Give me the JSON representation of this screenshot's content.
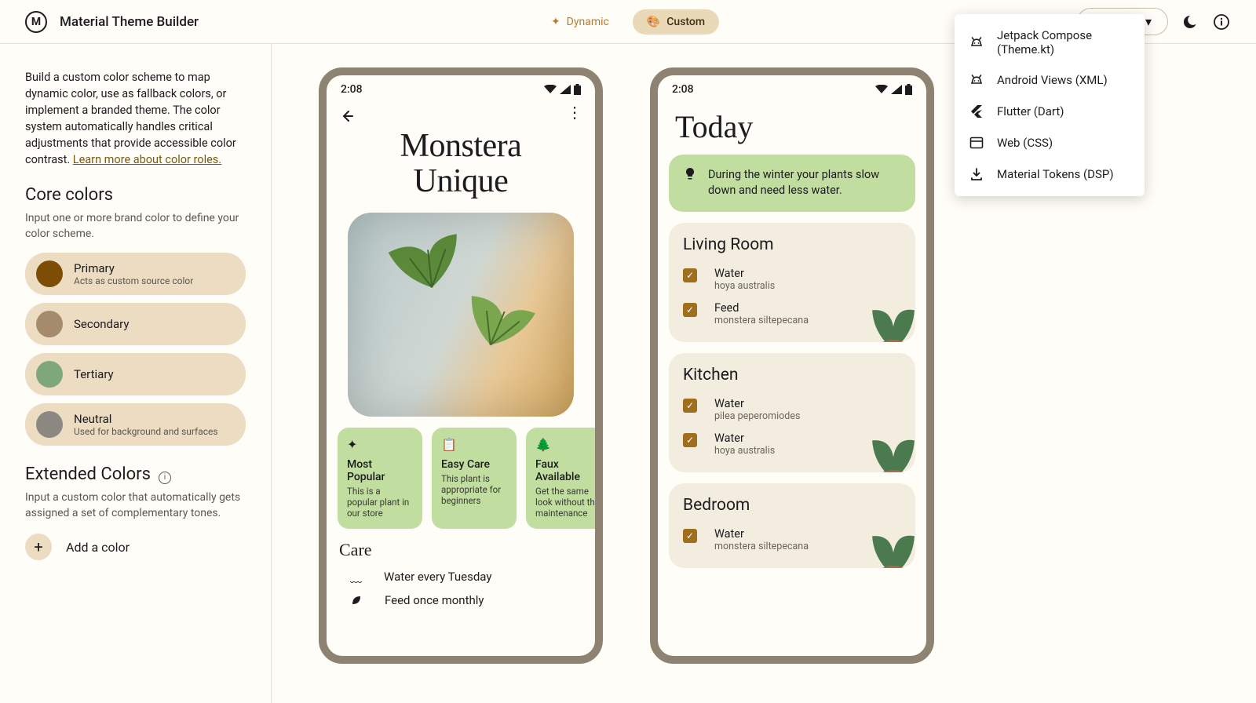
{
  "header": {
    "appTitle": "Material Theme Builder",
    "tabs": {
      "dynamic": "Dynamic",
      "custom": "Custom"
    },
    "exportMenu": [
      "Jetpack Compose (Theme.kt)",
      "Android Views (XML)",
      "Flutter (Dart)",
      "Web (CSS)",
      "Material Tokens (DSP)"
    ]
  },
  "sidebar": {
    "introA": "Build a custom color scheme to map dynamic color, use as fallback colors, or implement a branded theme. The color system automatically handles critical adjustments that provide accessible color contrast. ",
    "introLink": "Learn more about color roles.",
    "coreH": "Core colors",
    "coreSub": "Input one or more brand color to define your color scheme.",
    "colors": [
      {
        "label": "Primary",
        "sub": "Acts as custom source color",
        "hex": "#7e4d05"
      },
      {
        "label": "Secondary",
        "sub": "",
        "hex": "#a58a6c"
      },
      {
        "label": "Tertiary",
        "sub": "",
        "hex": "#7ea77b"
      },
      {
        "label": "Neutral",
        "sub": "Used for background and surfaces",
        "hex": "#8c8781"
      }
    ],
    "extH": "Extended Colors",
    "extSub": "Input a custom color that automatically gets assigned a set of complementary tones.",
    "addLabel": "Add a color"
  },
  "preview1": {
    "time": "2:08",
    "title1": "Monstera",
    "title2": "Unique",
    "chips": [
      {
        "title": "Most Popular",
        "desc": "This is a popular plant in our store"
      },
      {
        "title": "Easy Care",
        "desc": "This plant is appropriate for beginners"
      },
      {
        "title": "Faux Available",
        "desc": "Get the same look without the maintenance"
      }
    ],
    "careH": "Care",
    "care": [
      "Water every Tuesday",
      "Feed once monthly"
    ]
  },
  "preview2": {
    "time": "2:08",
    "title": "Today",
    "banner": "During the winter your plants slow down and need less water.",
    "rooms": [
      {
        "name": "Living Room",
        "tasks": [
          {
            "t": "Water",
            "s": "hoya australis"
          },
          {
            "t": "Feed",
            "s": "monstera siltepecana"
          }
        ]
      },
      {
        "name": "Kitchen",
        "tasks": [
          {
            "t": "Water",
            "s": "pilea peperomiodes"
          },
          {
            "t": "Water",
            "s": "hoya australis"
          }
        ]
      },
      {
        "name": "Bedroom",
        "tasks": [
          {
            "t": "Water",
            "s": "monstera siltepecana"
          }
        ]
      }
    ]
  }
}
